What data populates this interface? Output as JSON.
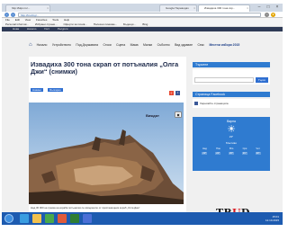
{
  "browser": {
    "tabs": [
      {
        "label": "http://kkpv.ru/...",
        "active": false
      },
      {
        "label": "Google Переводач",
        "active": false
      },
      {
        "label": "Извадиха 300 тона скр...",
        "active": true
      }
    ],
    "address": "http://trud.bg/...",
    "menu": [
      "File",
      "Edit",
      "View",
      "Favorites",
      "Tools",
      "Help"
    ],
    "favorites": [
      "Personal informat...",
      "Избрани страни...",
      "Оферти за почив...",
      "Полезни линкове...",
      "Бъдещи…",
      "Bing"
    ],
    "command_bar": [
      "Нова",
      "Начало",
      "Гост",
      "Ресурси"
    ]
  },
  "site_nav": {
    "items": [
      "Начало",
      "Устройството",
      "Под Държавата",
      "Стоки",
      "Сцена",
      "Мама",
      "Малки",
      "Съболно",
      "Вид здравие",
      "Секс",
      "Местни избори 2015"
    ]
  },
  "article": {
    "headline": "Извадиха 300 тона скрап от потъналия „Олга Джи“ (снимки)",
    "tags": [
      "Новини",
      "България"
    ],
    "photo_credit": "Виждат",
    "caption": "Над 30 000 на трюма на кораба потъналия се извършило от пристанищния кораб „Олга Джи“"
  },
  "sidebar": {
    "search_title": "Търсене",
    "search_button": "Търси",
    "page_title": "Страница Facebook",
    "page_link": "Харесайте страницата",
    "weather": {
      "city": "Варна",
      "temp": "23°",
      "date": "Мъгливо",
      "days": [
        "Нед",
        "Пон",
        "Вто",
        "Сря",
        "Чет"
      ],
      "values": [
        "22°",
        "21°",
        "20°",
        "21°",
        "23°"
      ]
    },
    "logo": "TRUD"
  },
  "taskbar": {
    "time": "15:01",
    "date": "12.10.2015"
  }
}
